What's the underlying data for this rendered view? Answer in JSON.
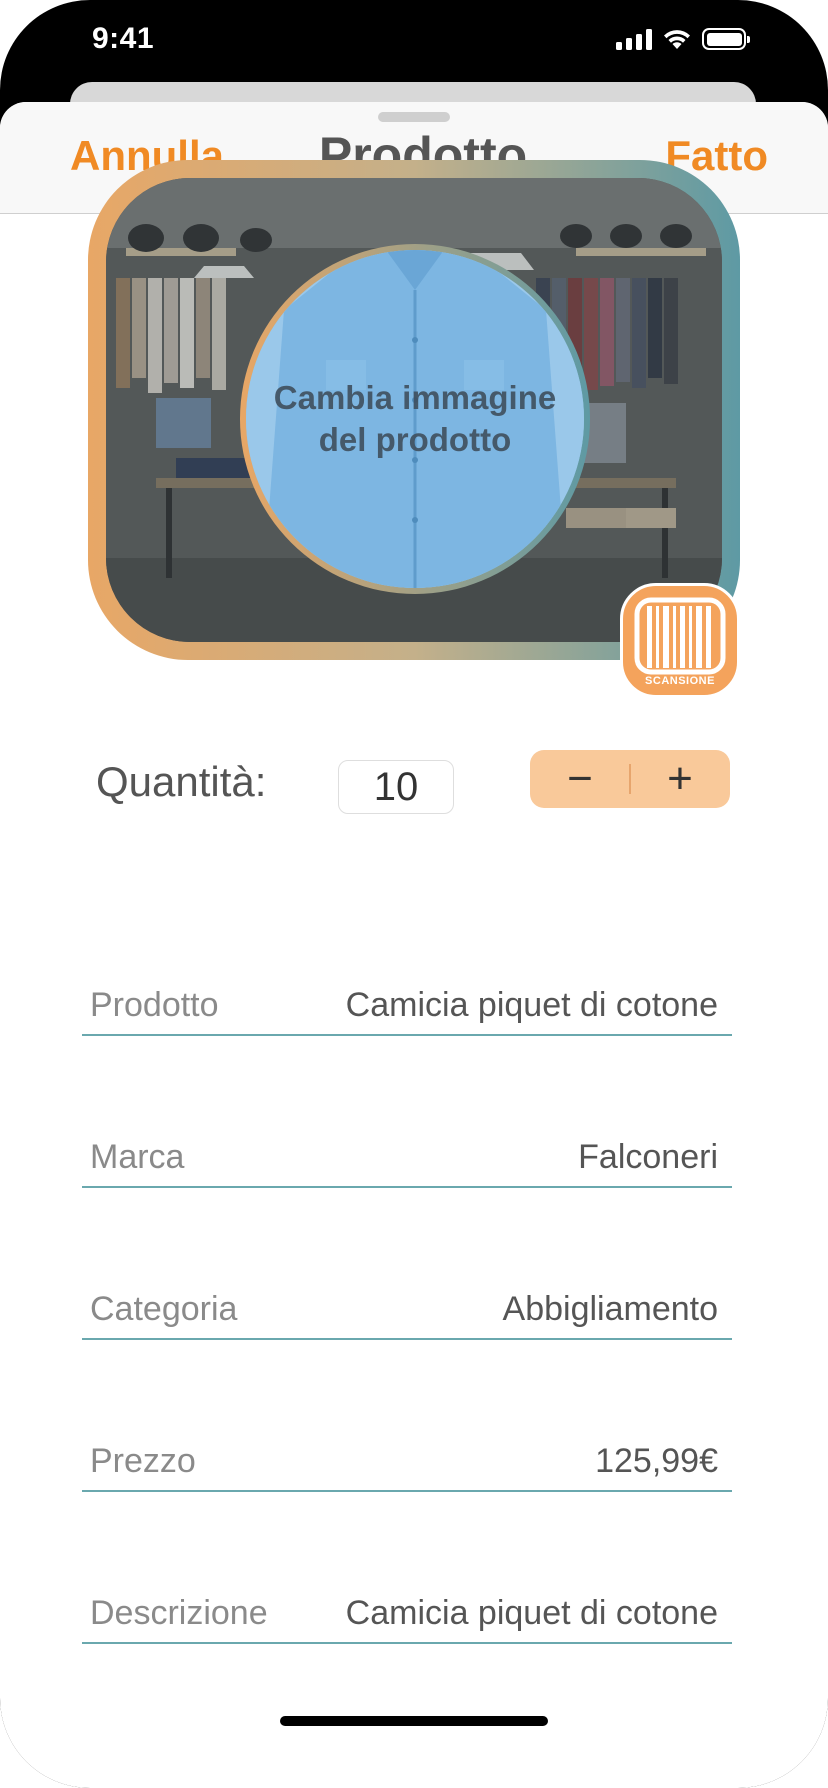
{
  "status_bar": {
    "time": "9:41"
  },
  "nav": {
    "cancel_label": "Annulla",
    "title": "Prodotto",
    "done_label": "Fatto"
  },
  "image": {
    "change_label": "Cambia immagine del prodotto"
  },
  "scan": {
    "label": "SCANSIONE"
  },
  "quantity": {
    "label": "Quantità:",
    "value": "10",
    "minus": "−",
    "plus": "+"
  },
  "fields": [
    {
      "label": "Prodotto",
      "value": "Camicia piquet di cotone"
    },
    {
      "label": "Marca",
      "value": "Falconeri"
    },
    {
      "label": "Categoria",
      "value": "Abbigliamento"
    },
    {
      "label": "Prezzo",
      "value": "125,99€"
    },
    {
      "label": "Descrizione",
      "value": "Camicia piquet di cotone"
    }
  ],
  "colors": {
    "accent": "#f08a24",
    "stepper": "#f9c99a",
    "underline": "#6aa8ae"
  }
}
